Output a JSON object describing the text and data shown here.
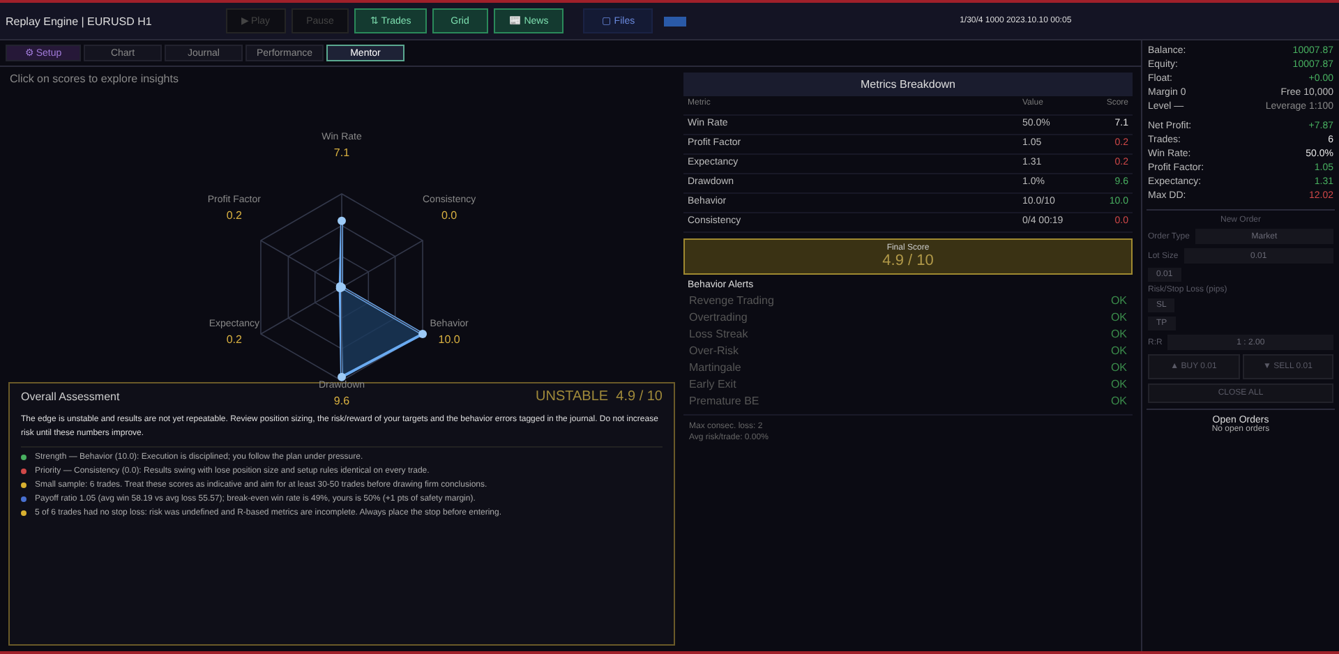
{
  "title": "Replay Engine | EURUSD H1",
  "toolbar": [
    {
      "label": "▶ Play",
      "disabled": true
    },
    {
      "label": "Pause",
      "disabled": true
    },
    {
      "label": "⇅ Trades",
      "disabled": false
    },
    {
      "label": "Grid",
      "disabled": false
    },
    {
      "label": "📰 News",
      "disabled": false
    }
  ],
  "files_button": "▢ Files",
  "progress": {
    "level": 1
  },
  "status": "1/30/4 1000 2023.10.10 00:05",
  "tabs": [
    {
      "label": "⚙ Setup",
      "selected": false,
      "kind": "setup"
    },
    {
      "label": "Chart",
      "selected": false,
      "kind": "plain"
    },
    {
      "label": "Journal",
      "selected": false,
      "kind": "plain"
    },
    {
      "label": "Performance",
      "selected": false,
      "kind": "plain"
    },
    {
      "label": "Mentor",
      "selected": true,
      "kind": "plain"
    }
  ],
  "hint": "Click on scores to explore insights",
  "radar": [
    {
      "label": "Win Rate",
      "score": "7.1"
    },
    {
      "label": "Profit Factor",
      "score": "0.2"
    },
    {
      "label": "Consistency",
      "score": "0.0"
    },
    {
      "label": "Expectancy",
      "score": "0.2"
    },
    {
      "label": "Behavior",
      "score": "10.0"
    },
    {
      "label": "Drawdown",
      "score": "9.6"
    }
  ],
  "metrics": {
    "title": "Metrics Breakdown",
    "columns": [
      "Metric",
      "Value",
      "Score"
    ],
    "rows": [
      {
        "metric": "Win Rate",
        "value": "50.0%",
        "score": "7.1",
        "color": "#e6e6e6"
      },
      {
        "metric": "Profit Factor",
        "value": "1.05",
        "score": "0.2",
        "color": "#d04848"
      },
      {
        "metric": "Expectancy",
        "value": "1.31",
        "score": "0.2",
        "color": "#d04848"
      },
      {
        "metric": "Drawdown",
        "value": "1.0%",
        "score": "9.6",
        "color": "#48b060"
      },
      {
        "metric": "Behavior",
        "value": "10.0/10",
        "score": "10.0",
        "color": "#48b060"
      },
      {
        "metric": "Consistency",
        "value": "0/4 00:19",
        "score": "0.0",
        "color": "#d04848"
      }
    ]
  },
  "final_score": {
    "label": "Final Score",
    "value": "4.9 / 10"
  },
  "alerts": {
    "title": "Behavior Alerts",
    "items": [
      {
        "label": "Revenge Trading",
        "status": "OK"
      },
      {
        "label": "Overtrading",
        "status": "OK"
      },
      {
        "label": "Loss Streak",
        "status": "OK"
      },
      {
        "label": "Over-Risk",
        "status": "OK"
      },
      {
        "label": "Martingale",
        "status": "OK"
      },
      {
        "label": "Early Exit",
        "status": "OK"
      },
      {
        "label": "Premature BE",
        "status": "OK"
      }
    ],
    "notes": [
      "Max consec. loss: 2",
      "Avg risk/trade: 0.00%"
    ]
  },
  "account": [
    {
      "label": "Balance:",
      "value": "10007.87",
      "color": "#48b060"
    },
    {
      "label": "Equity:",
      "value": "10007.87",
      "color": "#48b060"
    },
    {
      "label": "Float:",
      "value": "+0.00",
      "color": "#48b060"
    },
    {
      "label": "Margin 0",
      "value": "Free 10,000",
      "color": "#bbbbbb"
    },
    {
      "label": "Level —",
      "value": "Leverage 1:100",
      "color": "#888888"
    },
    {
      "label": "Net Profit:",
      "value": "+7.87",
      "color": "#48b060"
    },
    {
      "label": "Trades:",
      "value": "6",
      "color": "#e6e6e6"
    },
    {
      "label": "Win Rate:",
      "value": "50.0%",
      "color": "#e6e6e6"
    },
    {
      "label": "Profit Factor:",
      "value": "1.05",
      "color": "#48b060"
    },
    {
      "label": "Expectancy:",
      "value": "1.31",
      "color": "#48b060"
    },
    {
      "label": "Max DD:",
      "value": "12.02",
      "color": "#d04848"
    }
  ],
  "order": {
    "title": "New Order",
    "type_label": "Order Type",
    "type_value": "Market",
    "lot_label": "Lot Size",
    "lot_value": "0.01",
    "step": "0.01",
    "risk_label": "Risk/Stop Loss (pips)",
    "sl": "SL",
    "tp": "TP",
    "rr_label": "R:R",
    "rr_value": "1 : 2.00",
    "buy": "▲ BUY 0.01",
    "sell": "▼ SELL 0.01",
    "close": "CLOSE ALL"
  },
  "open_orders": {
    "title": "Open Orders",
    "empty": "No open orders"
  },
  "assessment": {
    "title": "Overall Assessment",
    "verdict": "UNSTABLE  4.9 / 10",
    "summary": "The edge is unstable and results are not yet repeatable. Review position sizing, the risk/reward of your targets and the behavior errors tagged in the journal. Do not increase risk until these numbers improve.",
    "items": [
      {
        "text": "Strength — Behavior (10.0): Execution is disciplined; you follow the plan under pressure.",
        "color": "#48b060"
      },
      {
        "text": "Priority — Consistency (0.0): Results swing with lose position size and setup rules identical on every trade.",
        "color": "#d04848"
      },
      {
        "text": "Small sample: 6 trades. Treat these scores as indicative and aim for at least 30-50 trades before drawing firm conclusions.",
        "color": "#d8b030"
      },
      {
        "text": "Payoff ratio 1.05 (avg win 58.19 vs avg loss 55.57); break-even win rate is 49%, yours is 50% (+1 pts of safety margin).",
        "color": "#4870d0"
      },
      {
        "text": "5 of 6 trades had no stop loss: risk was undefined and R-based metrics are incomplete. Always place the stop before entering.",
        "color": "#d8b030"
      }
    ]
  }
}
